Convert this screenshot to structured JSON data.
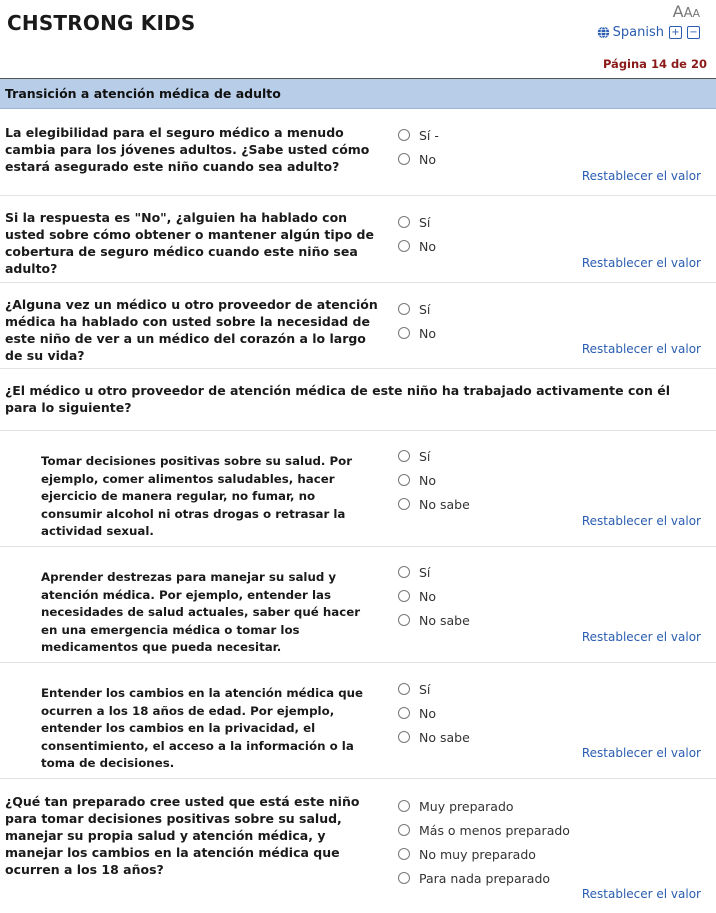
{
  "header": {
    "app_title": "CHSTRONG KIDS",
    "font_sizes": {
      "large": "A",
      "medium": "A",
      "small": "A"
    },
    "language": "Spanish",
    "zoom_in": "+",
    "zoom_out": "−",
    "page_indicator": "Página 14 de 20"
  },
  "section": {
    "title": "Transición a atención médica de adulto"
  },
  "reset_label": "Restablecer el valor",
  "questions": [
    {
      "text": "La elegibilidad para el seguro médico a menudo cambia para los jóvenes adultos. ¿Sabe usted cómo estará asegurado este niño cuando sea adulto?",
      "options": [
        "Sí -",
        "No"
      ]
    },
    {
      "text": "Si la respuesta es \"No\", ¿alguien ha hablado con usted sobre cómo obtener o mantener algún tipo de cobertura de seguro médico cuando este niño sea adulto?",
      "options": [
        "Sí",
        "No"
      ]
    },
    {
      "text": "¿Alguna vez un médico u otro proveedor de atención médica ha hablado con usted sobre la necesidad de este niño de ver a un médico del corazón a lo largo de su vida?",
      "options": [
        "Sí",
        "No"
      ]
    }
  ],
  "stem": {
    "text": "¿El médico u otro proveedor de atención médica de este niño ha trabajado activamente con él para lo siguiente?"
  },
  "sub_questions": [
    {
      "text": "Tomar decisiones positivas sobre su salud. Por ejemplo, comer alimentos saludables, hacer ejercicio de manera regular, no fumar, no consumir alcohol ni otras drogas o retrasar la actividad sexual.",
      "options": [
        "Sí",
        "No",
        "No sabe"
      ]
    },
    {
      "text": "Aprender destrezas para manejar su salud y atención médica. Por ejemplo, entender las necesidades de salud actuales, saber qué hacer en una emergencia médica o tomar los medicamentos que pueda necesitar.",
      "options": [
        "Sí",
        "No",
        "No sabe"
      ]
    },
    {
      "text": "Entender los cambios en la atención médica que ocurren a los 18 años de edad. Por ejemplo, entender los cambios en la privacidad, el consentimiento, el acceso a la información o la toma de decisiones.",
      "options": [
        "Sí",
        "No",
        "No sabe"
      ]
    }
  ],
  "final_question": {
    "text": "¿Qué tan preparado cree usted que está este niño para tomar decisiones positivas sobre su salud, manejar su propia salud y atención médica, y manejar los cambios en la atención médica que ocurren a los 18 años?",
    "options": [
      "Muy preparado",
      "Más o menos preparado",
      "No muy preparado",
      "Para nada preparado"
    ]
  }
}
